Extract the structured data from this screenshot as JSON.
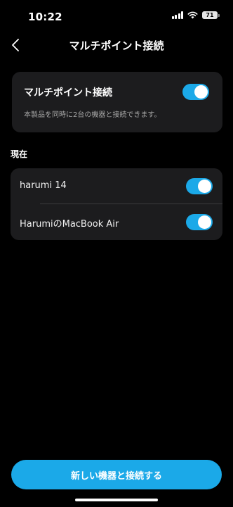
{
  "status": {
    "time": "10:22",
    "battery": "71"
  },
  "header": {
    "title": "マルチポイント接続"
  },
  "multipoint": {
    "title": "マルチポイント接続",
    "description": "本製品を同時に2台の機器と接続できます。",
    "enabled": true
  },
  "current": {
    "label": "現在",
    "devices": [
      {
        "name": "harumi 14",
        "enabled": true
      },
      {
        "name": "HarumiのMacBook Air",
        "enabled": true
      }
    ]
  },
  "actions": {
    "connect_new": "新しい機器と接続する"
  },
  "colors": {
    "accent": "#1ba9e8",
    "card": "#1c1c1e",
    "background": "#000000"
  }
}
